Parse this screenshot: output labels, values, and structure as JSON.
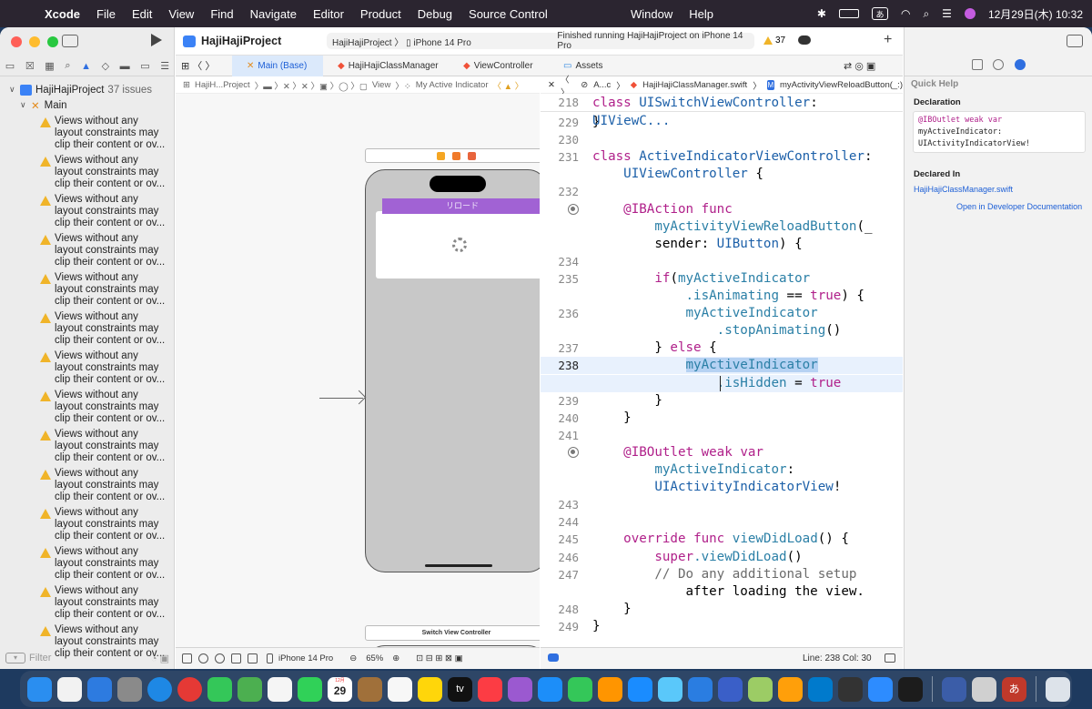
{
  "menubar": {
    "app": "Xcode",
    "menus": [
      "File",
      "Edit",
      "View",
      "Find",
      "Navigate",
      "Editor",
      "Product",
      "Debug",
      "Source Control"
    ],
    "center_menus": [
      "Window",
      "Help"
    ],
    "input_mode": "あ",
    "datetime": "12月29日(木)  10:32"
  },
  "toolbar": {
    "project_title": "HajiHajiProject",
    "scheme_project": "HajiHajiProject",
    "scheme_device": "iPhone 14 Pro",
    "status": "Finished running HajiHajiProject on iPhone 14 Pro",
    "warning_count": "37"
  },
  "navigator": {
    "project_name": "HajiHajiProject",
    "issue_count": "37 issues",
    "group": "Main",
    "warning_text": "Views without any layout constraints may clip their content or ov...",
    "filter_placeholder": "Filter"
  },
  "tabs": [
    {
      "label": "Main (Base)",
      "icon": "xib-icon"
    },
    {
      "label": "HajiHajiClassManager",
      "icon": "swift-icon"
    },
    {
      "label": "ViewController",
      "icon": "swift-icon"
    },
    {
      "label": "Assets",
      "icon": "assets-icon"
    }
  ],
  "jumpbar_left": {
    "project": "HajiH...Project",
    "view": "View",
    "item": "My Active Indicator"
  },
  "jumpbar_right": {
    "scope": "A...c",
    "file": "HajiHajiClassManager.swift",
    "method_badge": "M",
    "method": "myActivityViewReloadButton(_:)"
  },
  "canvas": {
    "reload_button": "リロード",
    "switch_scene_title": "Switch View Controller",
    "device": "iPhone 14 Pro",
    "zoom": "65%"
  },
  "editor": {
    "sticky_line": "218",
    "sticky_code": "class UISwitchViewController: UIViewC...",
    "lines": [
      {
        "n": "229",
        "text": "}"
      },
      {
        "n": "230",
        "text": ""
      },
      {
        "n": "231",
        "text": "class ActiveIndicatorViewController:"
      },
      {
        "n": "",
        "text": "    UIViewController {"
      },
      {
        "n": "232",
        "text": ""
      },
      {
        "n": "",
        "text": "    @IBAction func"
      },
      {
        "n": "",
        "text": "        myActivityViewReloadButton(_"
      },
      {
        "n": "",
        "text": "        sender: UIButton) {"
      },
      {
        "n": "234",
        "text": ""
      },
      {
        "n": "235",
        "text": "        if(myActiveIndicator"
      },
      {
        "n": "",
        "text": "            .isAnimating == true) {"
      },
      {
        "n": "236",
        "text": "            myActiveIndicator"
      },
      {
        "n": "",
        "text": "                .stopAnimating()"
      },
      {
        "n": "237",
        "text": "        } else {"
      },
      {
        "n": "238",
        "text": "            myActiveIndicator"
      },
      {
        "n": "",
        "text": "                .isHidden = true"
      },
      {
        "n": "239",
        "text": "        }"
      },
      {
        "n": "240",
        "text": "    }"
      },
      {
        "n": "241",
        "text": ""
      },
      {
        "n": "",
        "text": "    @IBOutlet weak var"
      },
      {
        "n": "",
        "text": "        myActiveIndicator:"
      },
      {
        "n": "",
        "text": "        UIActivityIndicatorView!"
      },
      {
        "n": "243",
        "text": ""
      },
      {
        "n": "244",
        "text": ""
      },
      {
        "n": "245",
        "text": "    override func viewDidLoad() {"
      },
      {
        "n": "246",
        "text": "        super.viewDidLoad()"
      },
      {
        "n": "247",
        "text": "        // Do any additional setup"
      },
      {
        "n": "",
        "text": "            after loading the view."
      },
      {
        "n": "248",
        "text": "    }"
      },
      {
        "n": "249",
        "text": "}"
      }
    ],
    "status": "Line: 238  Col: 30"
  },
  "inspector": {
    "title": "Quick Help",
    "declaration_label": "Declaration",
    "declaration_kw": "@IBOutlet weak var",
    "declaration_name": "myActiveIndicator:",
    "declaration_type": "UIActivityIndicatorView!",
    "declared_in_label": "Declared In",
    "declared_file": "HajiHajiClassManager.swift",
    "doc_link": "Open in Developer Documentation"
  },
  "dock": {
    "calendar_month": "12月",
    "calendar_day": "29",
    "tv_label": "tv",
    "input_label": "あ"
  },
  "colors": {
    "keyword": "#b0208a",
    "type": "#1b5fa8",
    "warning": "#f0b429",
    "accent": "#1d5fd6",
    "reload_button": "#a162d4"
  }
}
